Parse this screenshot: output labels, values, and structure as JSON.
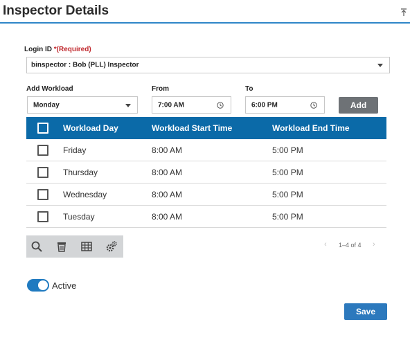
{
  "header": {
    "title": "Inspector Details"
  },
  "login": {
    "label": "Login ID",
    "required": "*(Required)",
    "value": "binspector : Bob (PLL) Inspector"
  },
  "workload_form": {
    "add_label": "Add Workload",
    "day_value": "Monday",
    "from_label": "From",
    "from_value": "7:00 AM",
    "to_label": "To",
    "to_value": "6:00 PM",
    "add_button": "Add"
  },
  "grid": {
    "columns": [
      "Workload Day",
      "Workload Start Time",
      "Workload End Time"
    ],
    "rows": [
      {
        "day": "Friday",
        "start": "8:00 AM",
        "end": "5:00 PM"
      },
      {
        "day": "Thursday",
        "start": "8:00 AM",
        "end": "5:00 PM"
      },
      {
        "day": "Wednesday",
        "start": "8:00 AM",
        "end": "5:00 PM"
      },
      {
        "day": "Tuesday",
        "start": "8:00 AM",
        "end": "5:00 PM"
      }
    ]
  },
  "toolbar": {
    "icons": [
      "search-icon",
      "trash-icon",
      "table-icon",
      "settings-icon"
    ]
  },
  "pager": {
    "range": "1–4 of 4"
  },
  "status": {
    "label": "Active",
    "on": true
  },
  "footer": {
    "save": "Save"
  },
  "colors": {
    "header_bar": "#0b6aa8",
    "accent": "#2e86c8",
    "save": "#2c79bd",
    "add": "#6e7276",
    "required": "#c0282d"
  }
}
